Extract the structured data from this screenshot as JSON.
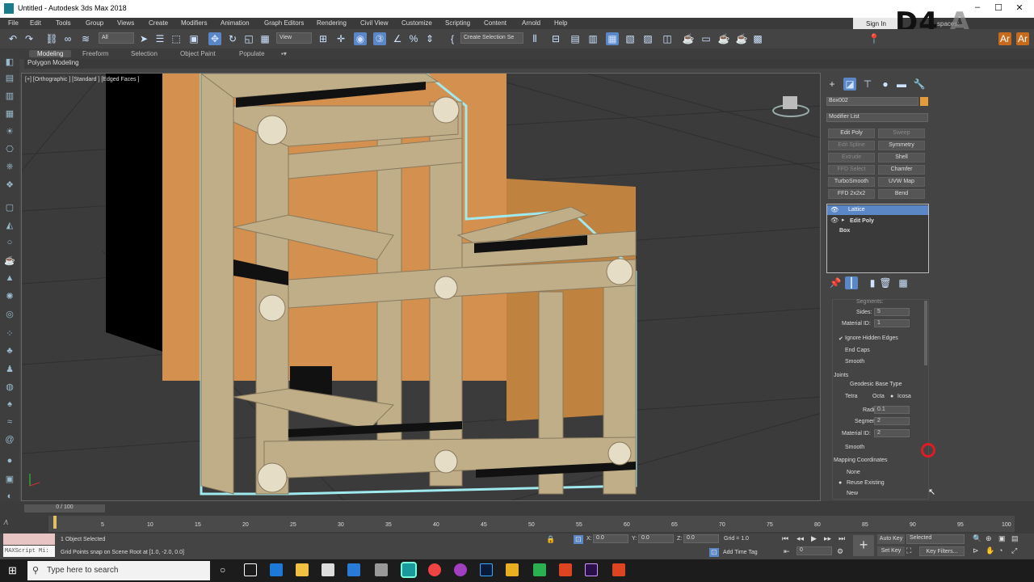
{
  "window": {
    "title": "Untitled - Autodesk 3ds Max 2018",
    "minimize": "–",
    "maximize": "☐",
    "close": "✕"
  },
  "menu": [
    "File",
    "Edit",
    "Tools",
    "Group",
    "Views",
    "Create",
    "Modifiers",
    "Animation",
    "Graph Editors",
    "Rendering",
    "Civil View",
    "Customize",
    "Scripting",
    "Content",
    "Arnold",
    "Help"
  ],
  "signin": "Sign In",
  "logo": {
    "text": "D4",
    "suffix": "A"
  },
  "workspaces": "spaces: ",
  "toolbar": {
    "filter": "All",
    "refcoord": "View",
    "selset": "Create Selection Se"
  },
  "ribbon": {
    "tabs": [
      "Modeling",
      "Freeform",
      "Selection",
      "Object Paint",
      "Populate"
    ],
    "sub": "Polygon Modeling"
  },
  "viewport": {
    "label": "[+] [Orthographic ] [Standard ] [Edged Faces ]"
  },
  "cmd": {
    "objname": "Box002",
    "objcolor": "#e59b3c",
    "modlist": "Modifier List",
    "modbuttons": [
      "Edit Poly",
      "Sweep",
      "Edit Spline",
      "Symmetry",
      "Extrude",
      "Shell",
      "FFD Select",
      "Chamfer",
      "TurboSmooth",
      "UVW Map",
      "FFD 2x2x2",
      "Bend"
    ],
    "stack": [
      "Lattice",
      "Edit Poly",
      "Box"
    ]
  },
  "params": {
    "segments_top": "Segments:",
    "sides": "Sides:",
    "sides_val": "5",
    "matid": "Material ID:",
    "matid_val": "1",
    "ignore": "Ignore Hidden Edges",
    "endcaps": "End Caps",
    "smooth1": "Smooth",
    "joints": "Joints",
    "geobase": "Geodesic Base Type",
    "tetra": "Tetra",
    "octa": "Octa",
    "icosa": "Icosa",
    "radius": "Radius:",
    "radius_val": "0.1",
    "segments": "Segments:",
    "segments_val": "2",
    "matid2": "Material ID:",
    "matid2_val": "2",
    "smooth2": "Smooth",
    "mapping": "Mapping Coordinates",
    "none": "None",
    "reuse": "Reuse Existing",
    "new": "New"
  },
  "timeline": {
    "frame": "0 / 100",
    "ticks": [
      "0",
      "5",
      "10",
      "15",
      "20",
      "25",
      "30",
      "35",
      "40",
      "45",
      "50",
      "55",
      "60",
      "65",
      "70",
      "75",
      "80",
      "85",
      "90",
      "95",
      "100"
    ]
  },
  "status": {
    "script": "MAXScript Mi:",
    "selected": "1 Object Selected",
    "prompt": "Grid Points snap on Scene Root at [1.0, -2.0, 0.0]",
    "x": "X:",
    "xv": "0.0",
    "y": "Y:",
    "yv": "0.0",
    "z": "Z:",
    "zv": "0.0",
    "grid": "Grid = 1.0",
    "addtag": "Add Time Tag",
    "autokey": "Auto Key",
    "selected_dd": "Selected",
    "setkey": "Set Key",
    "keyfilters": "Key Filters...",
    "frame": "0"
  },
  "taskbar": {
    "search": "Type here to search"
  }
}
